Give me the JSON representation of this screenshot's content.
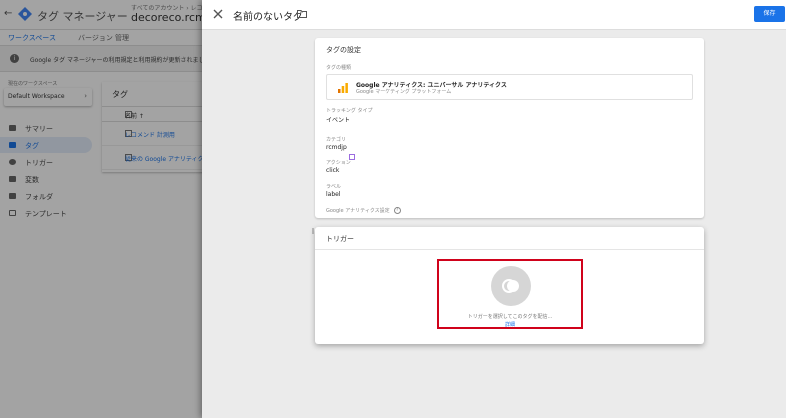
{
  "app": {
    "name": "タグ マネージャー",
    "breadcrumb": "すべてのアカウント › レコメ…",
    "container": "decoreco.rcmd.j"
  },
  "subnav": {
    "tabs": [
      "ワークスペース",
      "バージョン",
      "管理"
    ]
  },
  "notice": {
    "text": "Google タグ マネージャーの利用規定と利用規約が更新されました。"
  },
  "workspace": {
    "label": "現在のワークスペース",
    "value": "Default Workspace"
  },
  "sidebar": {
    "items": [
      {
        "label": "サマリー",
        "icon": "summary-icon"
      },
      {
        "label": "タグ",
        "icon": "tag-icon"
      },
      {
        "label": "トリガー",
        "icon": "trigger-icon"
      },
      {
        "label": "変数",
        "icon": "variable-icon"
      },
      {
        "label": "フォルダ",
        "icon": "folder-icon"
      },
      {
        "label": "テンプレート",
        "icon": "template-icon"
      }
    ]
  },
  "tag_list": {
    "title": "タグ",
    "column_name": "名前 ↑",
    "rows": [
      "レコメンド 計測用",
      "従来の Google アナリティクス"
    ]
  },
  "sheet": {
    "title": "名前のないタグ",
    "save_label": "保存"
  },
  "config": {
    "title": "タグの設定",
    "type_label": "タグの種類",
    "type_name": "Google アナリティクス: ユニバーサル アナリティクス",
    "type_sub": "Google マーケティング プラットフォーム",
    "tracking_label": "トラッキング タイプ",
    "tracking_value": "イベント",
    "category_label": "カテゴリ",
    "category_value": "rcmdjp",
    "action_label": "アクション",
    "action_value": "click",
    "label_label": "ラベル",
    "label_value": "label",
    "ga_settings_label": "Google アナリティクス設定"
  },
  "trigger": {
    "title": "トリガー",
    "hint": "トリガーを選択してこのタグを配信...",
    "link": "詳細"
  },
  "colors": {
    "accent": "#1a73e8",
    "highlight": "#d0021b",
    "ga_orange": "#f9ab00"
  }
}
